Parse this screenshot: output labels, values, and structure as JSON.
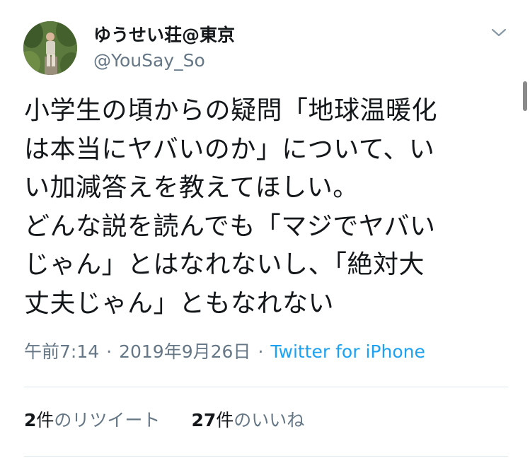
{
  "user": {
    "display_name": "ゆうせい荘@東京",
    "handle": "@YouSay_So",
    "avatar_icon": "avatar-photo-icon"
  },
  "menu": {
    "icon": "chevron-down-icon"
  },
  "tweet": {
    "lines": [
      "小学生の頃からの疑問「地球温暖化",
      "は本当にヤバいのか」について、い",
      "い加減答えを教えてほしい。",
      "どんな説を読んでも「マジでヤバい",
      "じゃん」とはなれないし、「絶対大",
      "丈夫じゃん」ともなれない"
    ]
  },
  "meta": {
    "time": "午前7:14",
    "separator": "·",
    "date": "2019年9月26日",
    "source": "Twitter for iPhone"
  },
  "stats": {
    "retweets": {
      "count": "2",
      "unit": "件",
      "label": "のリツイート"
    },
    "likes": {
      "count": "27",
      "unit": "件",
      "label": "のいいね"
    }
  },
  "colors": {
    "text": "#14171a",
    "secondary": "#657786",
    "link": "#1da1f2",
    "divider": "#e1e8ed"
  }
}
